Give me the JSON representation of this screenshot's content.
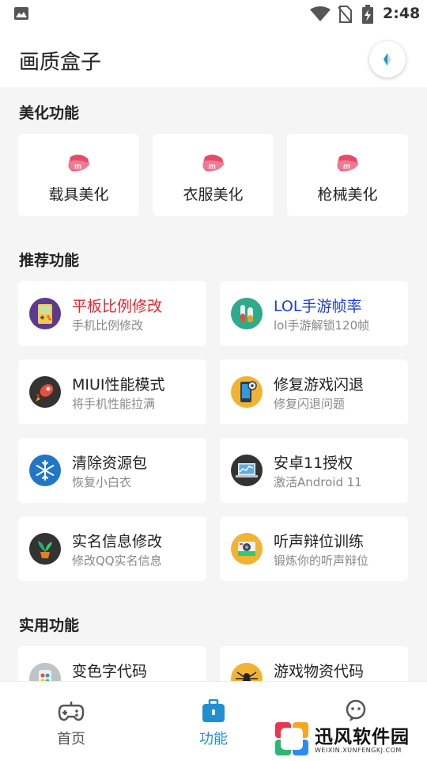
{
  "status_bar": {
    "time": "2:48",
    "icons": [
      "image-icon",
      "wifi-icon",
      "no-sim-icon",
      "battery-charging-icon"
    ]
  },
  "app_bar": {
    "title": "画质盒子",
    "action_icon": "compass-icon"
  },
  "sections": {
    "beautify": {
      "title": "美化功能",
      "items": [
        {
          "label": "载具美化",
          "icon": "pink-badge-icon"
        },
        {
          "label": "衣服美化",
          "icon": "pink-badge-icon"
        },
        {
          "label": "枪械美化",
          "icon": "pink-badge-icon"
        }
      ]
    },
    "recommended": {
      "title": "推荐功能",
      "items": [
        {
          "title": "平板比例修改",
          "subtitle": "手机比例修改",
          "title_color": "#e8252e",
          "icon": "gameboy-icon"
        },
        {
          "title": "LOL手游帧率",
          "subtitle": "lol手游解锁120帧",
          "title_color": "#1d3fd8",
          "icon": "chemistry-icon"
        },
        {
          "title": "MIUI性能模式",
          "subtitle": "将手机性能拉满",
          "title_color": "#222222",
          "icon": "rocket-icon"
        },
        {
          "title": "修复游戏闪退",
          "subtitle": "修复闪退问题",
          "title_color": "#222222",
          "icon": "phone-settings-icon"
        },
        {
          "title": "清除资源包",
          "subtitle": "恢复小白衣",
          "title_color": "#222222",
          "icon": "snowflake-icon"
        },
        {
          "title": "安卓11授权",
          "subtitle": "激活Android 11",
          "title_color": "#222222",
          "icon": "laptop-chart-icon"
        },
        {
          "title": "实名信息修改",
          "subtitle": "修改QQ实名信息",
          "title_color": "#222222",
          "icon": "plant-icon"
        },
        {
          "title": "听声辩位训练",
          "subtitle": "锻炼你的听声辩位",
          "title_color": "#222222",
          "icon": "camera-icon"
        }
      ]
    },
    "utility": {
      "title": "实用功能",
      "items": [
        {
          "title": "变色字代码",
          "icon": "color-palette-icon"
        },
        {
          "title": "游戏物资代码",
          "icon": "spider-icon"
        }
      ]
    }
  },
  "bottom_nav": {
    "items": [
      {
        "label": "首页",
        "icon": "gamepad-icon",
        "active": false
      },
      {
        "label": "功能",
        "icon": "toolbox-icon",
        "active": true
      },
      {
        "label": "",
        "icon": "chat-icon",
        "active": false
      }
    ],
    "active_color": "#1f8fd0",
    "inactive_color": "#555555"
  },
  "watermark": {
    "text": "迅风软件园",
    "sub": "WEIXIN.XUNFENGKJ.COM"
  }
}
